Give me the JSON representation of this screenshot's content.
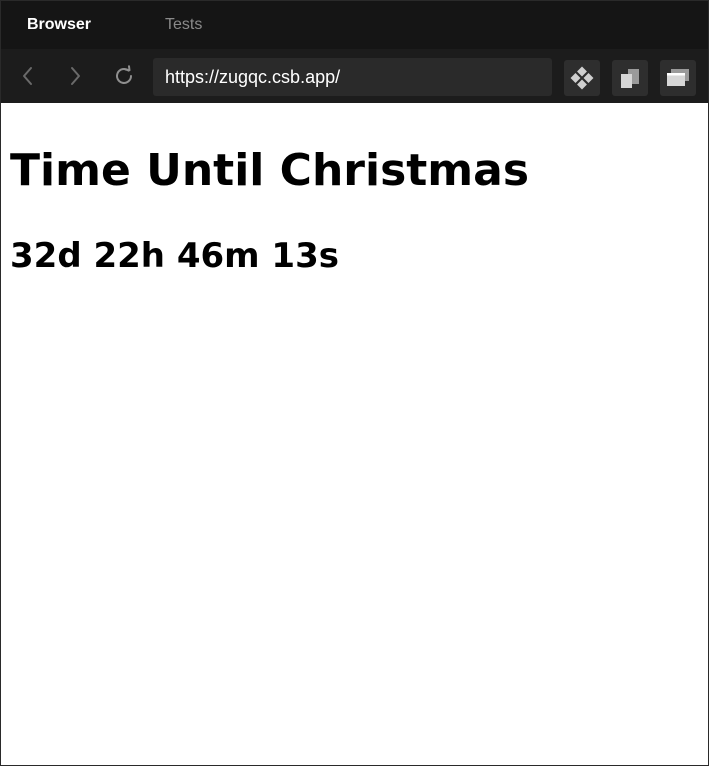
{
  "tabs": [
    {
      "label": "Browser",
      "active": true
    },
    {
      "label": "Tests",
      "active": false
    }
  ],
  "toolbar": {
    "back_icon": "chevron-left-icon",
    "forward_icon": "chevron-right-icon",
    "reload_icon": "reload-icon",
    "url": "https://zugqc.csb.app/",
    "tools": [
      "codesandbox-icon",
      "open-in-window-icon",
      "new-window-icon"
    ]
  },
  "page": {
    "title": "Time Until Christmas",
    "countdown": "32d 22h 46m 13s"
  },
  "colors": {
    "tabbar_bg": "#151515",
    "toolbar_bg": "#1c1c1c",
    "address_bg": "#2a2a2a",
    "active_tab_text": "#ffffff",
    "inactive_tab_text": "#8a8a8a"
  }
}
